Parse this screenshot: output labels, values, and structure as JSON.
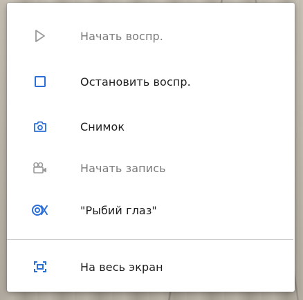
{
  "colors": {
    "accent": "#2b6fd6",
    "disabled_icon": "#9a9a9a"
  },
  "menu": {
    "items": [
      {
        "label": "Начать воспр.",
        "icon": "play-icon",
        "enabled": false
      },
      {
        "label": "Остановить воспр.",
        "icon": "stop-icon",
        "enabled": true
      },
      {
        "label": "Снимок",
        "icon": "camera-icon",
        "enabled": true
      },
      {
        "label": "Начать запись",
        "icon": "video-camera-icon",
        "enabled": false
      },
      {
        "label": "\"Рыбий глаз\"",
        "icon": "fisheye-icon",
        "enabled": true
      },
      {
        "label": "На весь экран",
        "icon": "fullscreen-icon",
        "enabled": true
      }
    ]
  }
}
